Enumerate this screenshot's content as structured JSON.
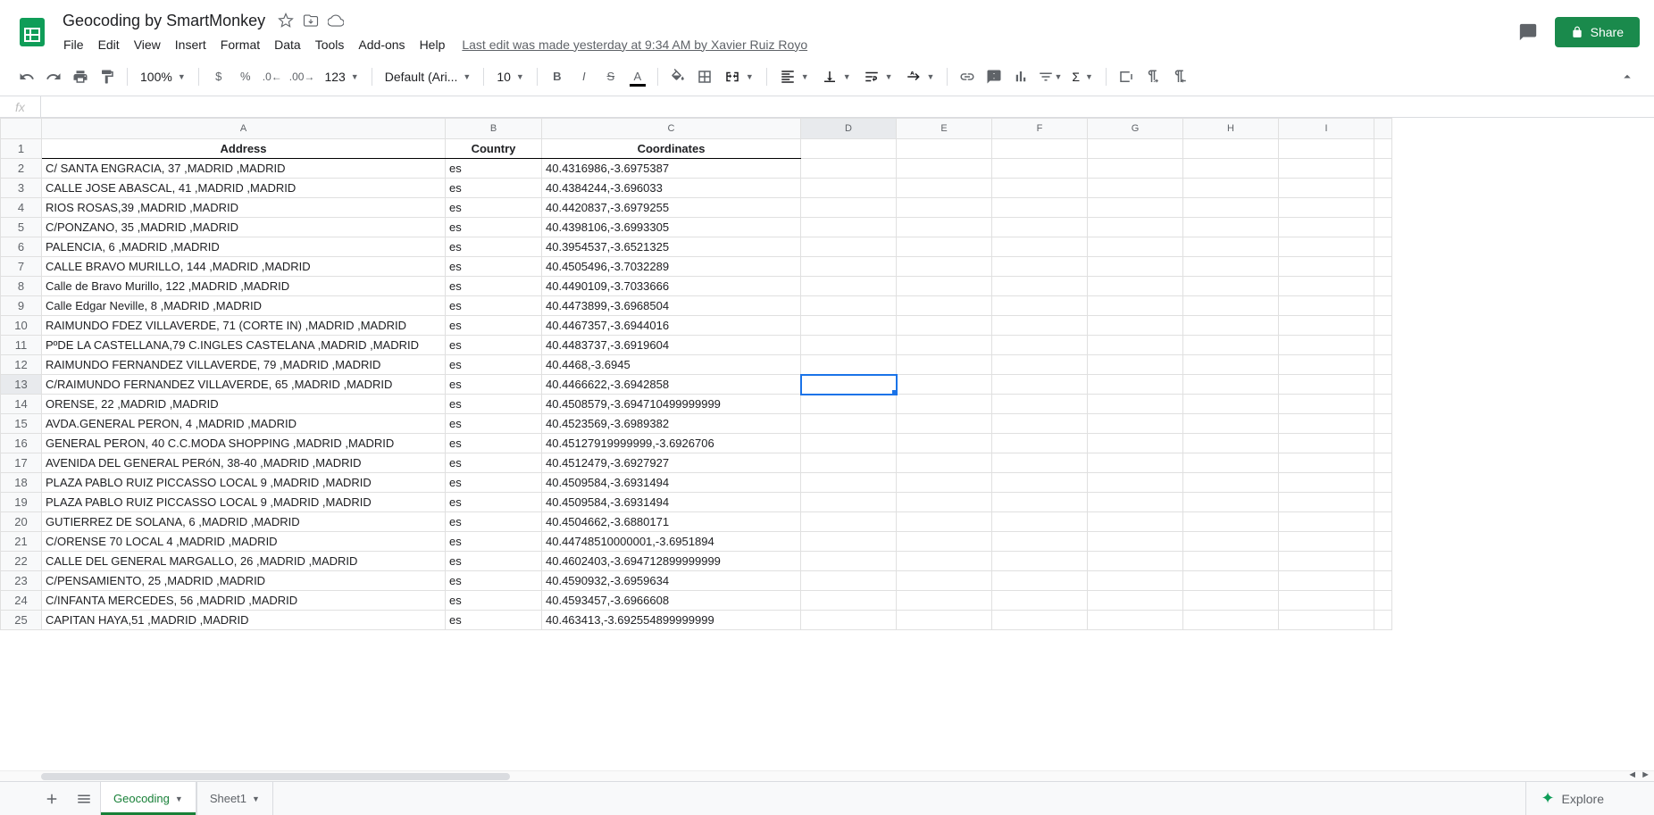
{
  "doc": {
    "title": "Geocoding by SmartMonkey",
    "last_edit": "Last edit was made yesterday at 9:34 AM by Xavier Ruiz Royo",
    "share": "Share"
  },
  "menu": [
    "File",
    "Edit",
    "View",
    "Insert",
    "Format",
    "Data",
    "Tools",
    "Add-ons",
    "Help"
  ],
  "toolbar": {
    "zoom": "100%",
    "font": "Default (Ari...",
    "font_size": "10",
    "number_format": "123"
  },
  "fx": {
    "label": "fx",
    "value": ""
  },
  "columns": [
    "A",
    "B",
    "C",
    "D",
    "E",
    "F",
    "G",
    "H",
    "I"
  ],
  "headers": {
    "A": "Address",
    "B": "Country",
    "C": "Coordinates"
  },
  "rows": [
    {
      "n": 1,
      "a": "Address",
      "b": "Country",
      "c": "Coordinates",
      "hdr": true
    },
    {
      "n": 2,
      "a": "C/ SANTA ENGRACIA, 37 ,MADRID ,MADRID",
      "b": "es",
      "c": "40.4316986,-3.6975387"
    },
    {
      "n": 3,
      "a": "CALLE JOSE ABASCAL, 41 ,MADRID ,MADRID",
      "b": "es",
      "c": "40.4384244,-3.696033"
    },
    {
      "n": 4,
      "a": "RIOS ROSAS,39 ,MADRID ,MADRID",
      "b": "es",
      "c": "40.4420837,-3.6979255"
    },
    {
      "n": 5,
      "a": "C/PONZANO, 35 ,MADRID ,MADRID",
      "b": "es",
      "c": "40.4398106,-3.6993305"
    },
    {
      "n": 6,
      "a": "PALENCIA, 6 ,MADRID ,MADRID",
      "b": "es",
      "c": "40.3954537,-3.6521325"
    },
    {
      "n": 7,
      "a": "CALLE BRAVO MURILLO, 144 ,MADRID ,MADRID",
      "b": "es",
      "c": "40.4505496,-3.7032289"
    },
    {
      "n": 8,
      "a": "Calle de Bravo Murillo, 122 ,MADRID ,MADRID",
      "b": "es",
      "c": "40.4490109,-3.7033666"
    },
    {
      "n": 9,
      "a": "Calle Edgar Neville, 8 ,MADRID ,MADRID",
      "b": "es",
      "c": "40.4473899,-3.6968504"
    },
    {
      "n": 10,
      "a": "RAIMUNDO FDEZ VILLAVERDE, 71 (CORTE IN) ,MADRID ,MADRID",
      "b": "es",
      "c": "40.4467357,-3.6944016"
    },
    {
      "n": 11,
      "a": "PºDE LA CASTELLANA,79 C.INGLES CASTELANA ,MADRID ,MADRID",
      "b": "es",
      "c": "40.4483737,-3.6919604"
    },
    {
      "n": 12,
      "a": "RAIMUNDO FERNANDEZ VILLAVERDE, 79 ,MADRID ,MADRID",
      "b": "es",
      "c": "40.4468,-3.6945"
    },
    {
      "n": 13,
      "a": "C/RAIMUNDO FERNANDEZ VILLAVERDE, 65 ,MADRID ,MADRID",
      "b": "es",
      "c": "40.4466622,-3.6942858"
    },
    {
      "n": 14,
      "a": "ORENSE, 22 ,MADRID ,MADRID",
      "b": "es",
      "c": "40.4508579,-3.694710499999999"
    },
    {
      "n": 15,
      "a": "AVDA.GENERAL PERON, 4 ,MADRID ,MADRID",
      "b": "es",
      "c": "40.4523569,-3.6989382"
    },
    {
      "n": 16,
      "a": "GENERAL PERON, 40 C.C.MODA SHOPPING ,MADRID ,MADRID",
      "b": "es",
      "c": "40.45127919999999,-3.6926706"
    },
    {
      "n": 17,
      "a": "AVENIDA DEL GENERAL PERóN, 38-40 ,MADRID ,MADRID",
      "b": "es",
      "c": "40.4512479,-3.6927927"
    },
    {
      "n": 18,
      "a": "PLAZA PABLO RUIZ PICCASSO LOCAL 9 ,MADRID ,MADRID",
      "b": "es",
      "c": "40.4509584,-3.6931494"
    },
    {
      "n": 19,
      "a": "PLAZA PABLO RUIZ PICCASSO LOCAL 9 ,MADRID ,MADRID",
      "b": "es",
      "c": "40.4509584,-3.6931494"
    },
    {
      "n": 20,
      "a": "GUTIERREZ DE SOLANA, 6 ,MADRID ,MADRID",
      "b": "es",
      "c": "40.4504662,-3.6880171"
    },
    {
      "n": 21,
      "a": "C/ORENSE 70 LOCAL 4 ,MADRID ,MADRID",
      "b": "es",
      "c": "40.44748510000001,-3.6951894"
    },
    {
      "n": 22,
      "a": "CALLE DEL GENERAL MARGALLO, 26 ,MADRID ,MADRID",
      "b": "es",
      "c": "40.4602403,-3.694712899999999"
    },
    {
      "n": 23,
      "a": "C/PENSAMIENTO, 25 ,MADRID ,MADRID",
      "b": "es",
      "c": "40.4590932,-3.6959634"
    },
    {
      "n": 24,
      "a": "C/INFANTA MERCEDES, 56 ,MADRID ,MADRID",
      "b": "es",
      "c": "40.4593457,-3.6966608"
    },
    {
      "n": 25,
      "a": "CAPITAN HAYA,51 ,MADRID ,MADRID",
      "b": "es",
      "c": "40.463413,-3.692554899999999"
    }
  ],
  "active_cell": {
    "col": "D",
    "row": 13
  },
  "sheets": {
    "tabs": [
      {
        "name": "Geocoding",
        "active": true
      },
      {
        "name": "Sheet1",
        "active": false
      }
    ],
    "explore": "Explore"
  }
}
